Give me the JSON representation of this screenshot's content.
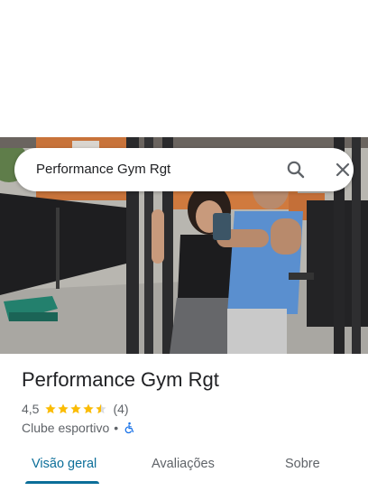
{
  "search": {
    "query": "Performance Gym Rgt"
  },
  "place": {
    "title": "Performance Gym Rgt",
    "rating": "4,5",
    "stars": 4.5,
    "review_count": "(4)",
    "category": "Clube esportivo",
    "separator": "•"
  },
  "tabs": [
    {
      "label": "Visão geral",
      "active": true
    },
    {
      "label": "Avaliações",
      "active": false
    },
    {
      "label": "Sobre",
      "active": false
    }
  ],
  "icons": {
    "search": "search-icon",
    "close": "close-icon",
    "accessibility": "wheelchair-icon",
    "star": "star-icon"
  },
  "colors": {
    "star": "#fbbc04",
    "accent": "#0b6e99",
    "accessibility": "#1a73e8"
  }
}
